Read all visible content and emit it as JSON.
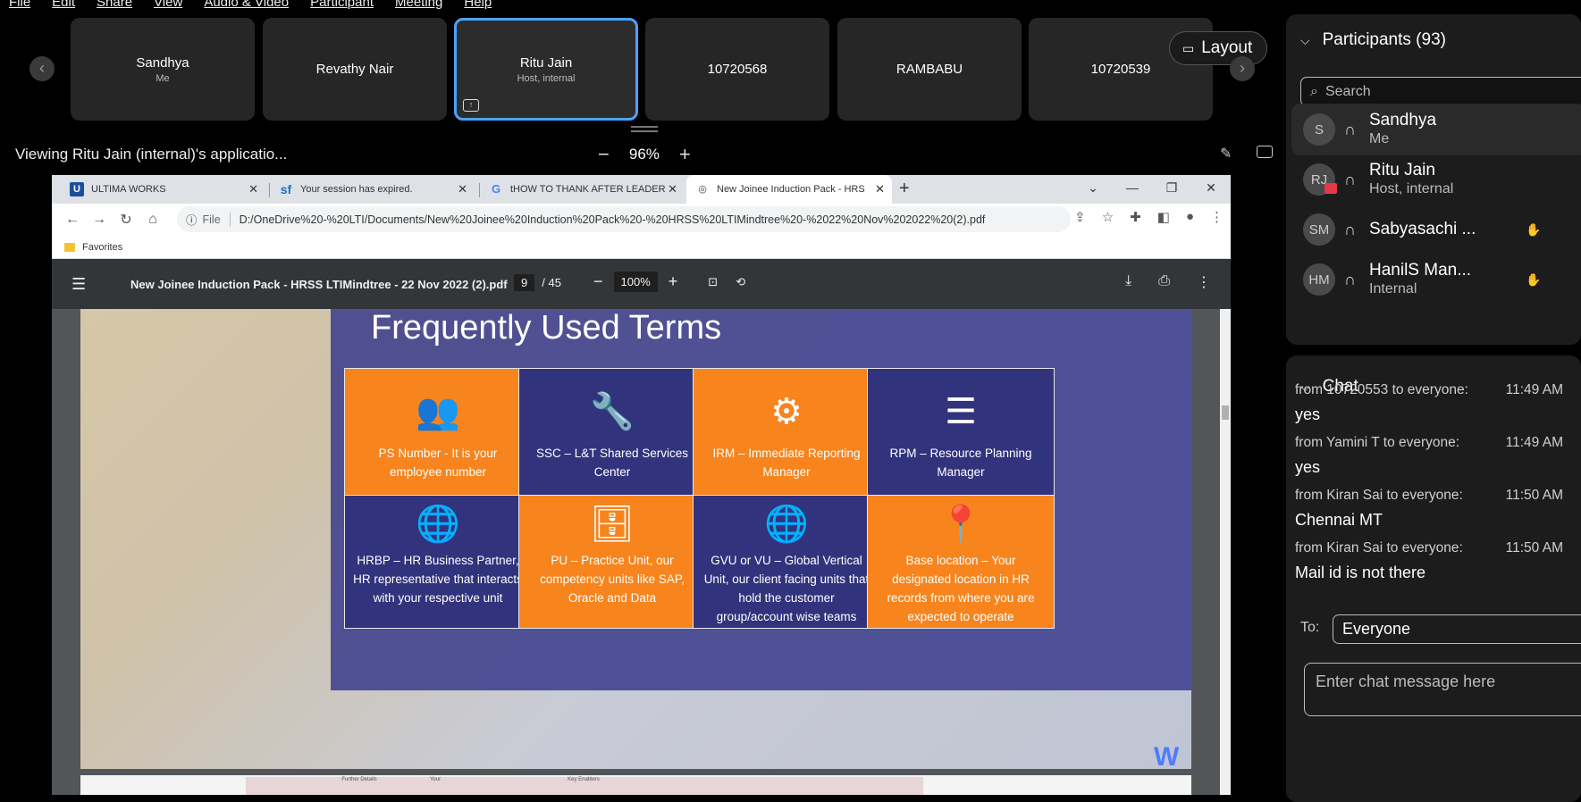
{
  "menubar": [
    "File",
    "Edit",
    "Share",
    "View",
    "Audio & Video",
    "Participant",
    "Meeting",
    "Help"
  ],
  "filmstrip": [
    {
      "name": "Sandhya",
      "sub": "Me"
    },
    {
      "name": "Revathy Nair",
      "sub": ""
    },
    {
      "name": "Ritu Jain",
      "sub": "Host, internal"
    },
    {
      "name": "10720568",
      "sub": ""
    },
    {
      "name": "RAMBABU",
      "sub": ""
    },
    {
      "name": "10720539",
      "sub": ""
    }
  ],
  "layout_label": "Layout",
  "viewing_text": "Viewing Ritu Jain (internal)'s applicatio...",
  "zoom": {
    "value": "96%",
    "minus": "−",
    "plus": "+"
  },
  "browser": {
    "tabs": [
      {
        "label": "ULTIMA WORKS",
        "fav": "U"
      },
      {
        "label": "Your session has expired.",
        "fav": "sf"
      },
      {
        "label": "tHOW TO THANK AFTER LEADER",
        "fav": "G"
      },
      {
        "label": "New Joinee Induction Pack - HRS",
        "fav": "◎"
      }
    ],
    "file_label": "File",
    "url": "D:/OneDrive%20-%20LTI/Documents/New%20Joinee%20Induction%20Pack%20-%20HRSS%20LTIMindtree%20-%2022%20Nov%202022%20(2).pdf",
    "favorites": "Favorites"
  },
  "pdf": {
    "title": "New Joinee Induction Pack - HRSS LTIMindtree - 22 Nov 2022 (2).pdf",
    "page": "9",
    "pages": "/ 45",
    "zoom": "100%"
  },
  "slide": {
    "title": "Frequently Used Terms",
    "cards": [
      {
        "text": "PS Number - It is your employee number",
        "color": "or",
        "icon": "👥"
      },
      {
        "text": "SSC – L&T Shared Services Center",
        "color": "nv",
        "icon": "🔧"
      },
      {
        "text": "IRM – Immediate Reporting Manager",
        "color": "or",
        "icon": "⚙"
      },
      {
        "text": "RPM – Resource Planning Manager",
        "color": "nv",
        "icon": "☰"
      },
      {
        "text": "HRBP – HR Business Partner, HR representative that interacts with your respective unit",
        "color": "nv",
        "icon": "🌐"
      },
      {
        "text": "PU – Practice Unit, our competency units like SAP, Oracle and Data",
        "color": "or",
        "icon": "🗄"
      },
      {
        "text": "GVU or VU – Global Vertical Unit, our client facing units that hold the customer group/account wise teams",
        "color": "nv",
        "icon": "🌐"
      },
      {
        "text": "Base location – Your designated location in HR records from where you are expected to operate",
        "color": "or",
        "icon": "📍"
      }
    ],
    "bottom_cells": [
      "",
      "Further Details",
      "Your",
      "",
      "Key Enablers",
      "",
      "",
      "",
      ""
    ]
  },
  "participants": {
    "header": "Participants (93)",
    "search_placeholder": "Search",
    "list": [
      {
        "initials": "S",
        "name": "Sandhya",
        "sub": "Me",
        "hand": false
      },
      {
        "initials": "RJ",
        "name": "Ritu Jain",
        "sub": "Host, internal",
        "hand": false
      },
      {
        "initials": "SM",
        "name": "Sabyasachi ...",
        "sub": "",
        "hand": true
      },
      {
        "initials": "HM",
        "name": "HanilS Man...",
        "sub": "Internal",
        "hand": true
      }
    ]
  },
  "chat": {
    "header": "Chat",
    "messages": [
      {
        "from": "from 10720553 to everyone:",
        "time": "11:49 AM",
        "text": "yes"
      },
      {
        "from": "from Yamini T to everyone:",
        "time": "11:49 AM",
        "text": "yes"
      },
      {
        "from": "from Kiran Sai to everyone:",
        "time": "11:50 AM",
        "text": "Chennai MT"
      },
      {
        "from": "from Kiran Sai to everyone:",
        "time": "11:50 AM",
        "text": "Mail id is not there"
      }
    ],
    "to_label": "To:",
    "to_value": "Everyone",
    "input_placeholder": "Enter chat message here"
  }
}
